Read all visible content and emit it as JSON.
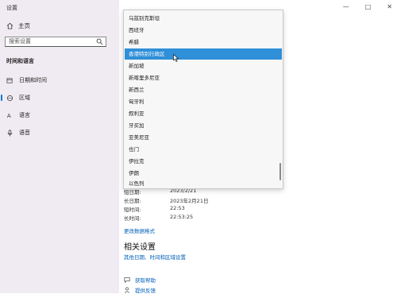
{
  "window": {
    "title": "设置",
    "controls": [
      "—",
      "□",
      "✕"
    ]
  },
  "sidebar": {
    "home_label": "主页",
    "search_placeholder": "搜索设置",
    "section_title": "时间和语言",
    "items": [
      {
        "label": "日期和时间",
        "icon": "calendar-clock-icon"
      },
      {
        "label": "区域",
        "icon": "globe-region-icon",
        "active": true
      },
      {
        "label": "语言",
        "icon": "language-icon"
      },
      {
        "label": "语音",
        "icon": "microphone-icon"
      }
    ]
  },
  "region_info": [
    {
      "label": "短日期:",
      "value": "2023/2/21"
    },
    {
      "label": "长日期:",
      "value": "2023年2月21日"
    },
    {
      "label": "短时间:",
      "value": "22:53"
    },
    {
      "label": "长时间:",
      "value": "22:53:25"
    }
  ],
  "change_format_link": "更改数据格式",
  "related": {
    "title": "相关设置",
    "link": "其他日期、时间和区域设置"
  },
  "help": [
    {
      "label": "获取帮助",
      "icon": "help-chat-icon"
    },
    {
      "label": "提供反馈",
      "icon": "feedback-icon"
    }
  ],
  "dropdown": {
    "items": [
      "乌兹别克斯坦",
      "西班牙",
      "希腊",
      "香港特别行政区",
      "新加坡",
      "新喀里多尼亚",
      "新西兰",
      "匈牙利",
      "叙利亚",
      "牙买加",
      "亚美尼亚",
      "也门",
      "伊拉克",
      "伊朗",
      "以色列"
    ],
    "selected_index": 3
  },
  "colors": {
    "accent": "#0078d4",
    "selected_bg": "#2f8fd8",
    "sidebar_bg": "#f0ebf2",
    "link": "#0060b8"
  }
}
